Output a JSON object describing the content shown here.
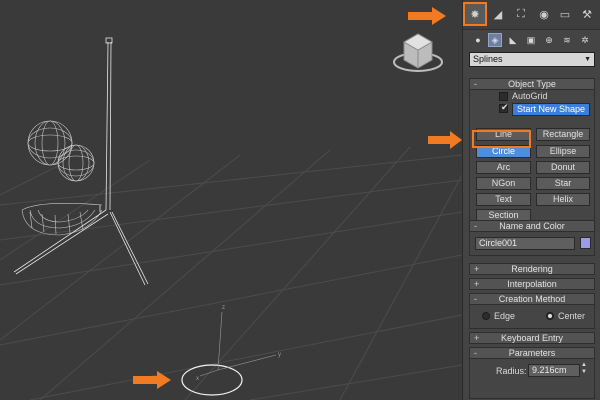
{
  "colors": {
    "accent": "#f07b22",
    "active_button": "#4d8ee0",
    "object_color": "#9b9be8"
  },
  "command_panel": {
    "tabs": [
      {
        "icon": "create-icon",
        "glyph": "✸",
        "active": true
      },
      {
        "icon": "modify-icon",
        "glyph": "◢",
        "active": false
      },
      {
        "icon": "hierarchy-icon",
        "glyph": "⛶",
        "active": false
      },
      {
        "icon": "motion-icon",
        "glyph": "◉",
        "active": false
      },
      {
        "icon": "display-icon",
        "glyph": "▭",
        "active": false
      },
      {
        "icon": "utilities-icon",
        "glyph": "⚒",
        "active": false
      }
    ],
    "categories": [
      {
        "icon": "geometry-icon",
        "glyph": "●",
        "active": false
      },
      {
        "icon": "shapes-icon",
        "glyph": "◈",
        "active": true
      },
      {
        "icon": "lights-icon",
        "glyph": "◣",
        "active": false
      },
      {
        "icon": "cameras-icon",
        "glyph": "▣",
        "active": false
      },
      {
        "icon": "helpers-icon",
        "glyph": "⊕",
        "active": false
      },
      {
        "icon": "space-warps-icon",
        "glyph": "≋",
        "active": false
      },
      {
        "icon": "systems-icon",
        "glyph": "✲",
        "active": false
      }
    ],
    "category_dropdown": "Splines",
    "object_type": {
      "title": "Object Type",
      "sign": "-",
      "autogrid_label": "AutoGrid",
      "start_new_shape_label": "Start New Shape",
      "buttons": [
        {
          "label": "Line",
          "active": false
        },
        {
          "label": "Rectangle",
          "active": false
        },
        {
          "label": "Circle",
          "active": true
        },
        {
          "label": "Ellipse",
          "active": false
        },
        {
          "label": "Arc",
          "active": false
        },
        {
          "label": "Donut",
          "active": false
        },
        {
          "label": "NGon",
          "active": false
        },
        {
          "label": "Star",
          "active": false
        },
        {
          "label": "Text",
          "active": false
        },
        {
          "label": "Helix",
          "active": false
        },
        {
          "label": "Section",
          "active": false
        }
      ]
    },
    "name_and_color": {
      "title": "Name and Color",
      "sign": "-",
      "name_value": "Circle001"
    },
    "rendering": {
      "title": "Rendering",
      "sign": "+"
    },
    "interpolation": {
      "title": "Interpolation",
      "sign": "+"
    },
    "creation_method": {
      "title": "Creation Method",
      "sign": "-",
      "edge_label": "Edge",
      "center_label": "Center",
      "selected": "Center"
    },
    "keyboard_entry": {
      "title": "Keyboard Entry",
      "sign": "+"
    },
    "parameters": {
      "title": "Parameters",
      "sign": "-",
      "radius_label": "Radius:",
      "radius_value": "9.216cm"
    }
  },
  "viewport": {
    "axis_x": "x",
    "axis_y": "y",
    "axis_z": "z"
  }
}
